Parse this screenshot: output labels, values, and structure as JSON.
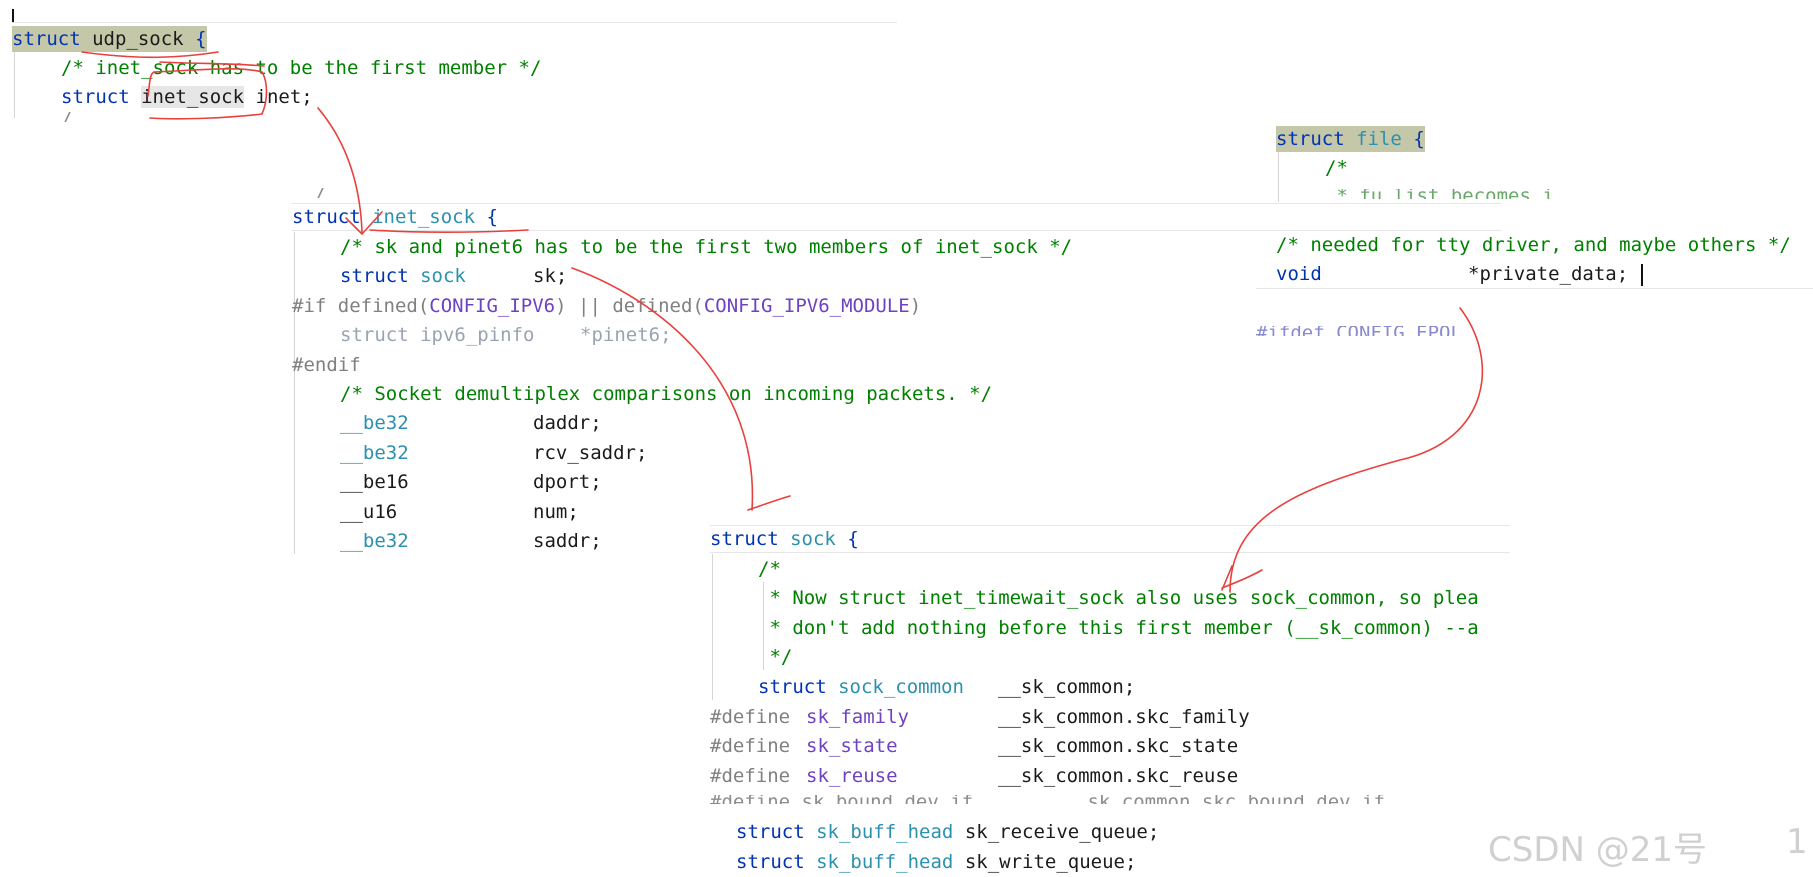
{
  "snippet_udp": {
    "header": [
      "struct",
      "udp_sock",
      "{"
    ],
    "line1": "/* inet_sock has to be the first member */",
    "line2_kw": "struct",
    "line2_type": "inet_sock",
    "line2_rest": "inet;",
    "line3_clipped": "/ ...   ...   ...   ...   ...   ..."
  },
  "snippet_inet": {
    "clipped_top": "/",
    "header": [
      "struct",
      "inet_sock",
      "{"
    ],
    "lines": [
      {
        "cm": "/* sk and pinet6 has to be the first two members of inet_sock */"
      },
      {
        "kw": "struct",
        "ty": "sock",
        "name": "sk;"
      },
      {
        "pp": "#if defined(",
        "mac1": "CONFIG_IPV6",
        "pp2": ") || defined(",
        "mac2": "CONFIG_IPV6_MODULE",
        "pp3": ")"
      },
      {
        "dimkw": "struct",
        "dimty": "ipv6_pinfo",
        "dimname": "*pinet6;"
      },
      {
        "pp": "#endif"
      },
      {
        "cm": "/* Socket demultiplex comparisons on incoming packets. */"
      },
      {
        "ty": "__be32",
        "name": "daddr;"
      },
      {
        "ty": "__be32",
        "name": "rcv_saddr;"
      },
      {
        "ty": "__be16",
        "name": "dport;"
      },
      {
        "ty": "__u16",
        "name": "num;"
      },
      {
        "ty": "__be32",
        "name": "saddr;"
      }
    ]
  },
  "snippet_file": {
    "header": [
      "struct",
      "file",
      "{"
    ],
    "c1": "/*",
    "c2_clipped": " * fu_list becomes i",
    "comment": "/* needed for tty driver, and maybe others */",
    "void": "void",
    "private": "*private_data;",
    "clipped_bottom": "#ifdef CONFIG_EPOLL"
  },
  "snippet_sock": {
    "header": [
      "struct",
      "sock",
      "{"
    ],
    "c_open": "/*",
    "c1": " * Now struct inet_timewait_sock also uses sock_common, so plea",
    "c2": " * don't add nothing before this first member (__sk_common) --a",
    "c_close": " */",
    "member_kw": "struct",
    "member_ty": "sock_common",
    "member_name": "__sk_common;",
    "defines": [
      {
        "pp": "#define",
        "mac": "sk_family",
        "val": "__sk_common.skc_family"
      },
      {
        "pp": "#define",
        "mac": "sk_state",
        "val": "__sk_common.skc_state"
      },
      {
        "pp": "#define",
        "mac": "sk_reuse",
        "val": "__sk_common.skc_reuse"
      }
    ],
    "clipped_define": "#define sk_bound_dev_if        __sk_common.skc_bound_dev_if",
    "queues": [
      {
        "kw": "struct",
        "ty": "sk_buff_head",
        "name": "sk_receive_queue;"
      },
      {
        "kw": "struct",
        "ty": "sk_buff_head",
        "name": "sk_write_queue;"
      }
    ]
  },
  "watermark": {
    "text": "CSDN @21号",
    "edge": "1"
  },
  "colors": {
    "keyword": "#0033b3",
    "type": "#2b91af",
    "comment": "#008000",
    "preprocessor": "#808080",
    "macro": "#6f42c1",
    "annotation": "#e8413d"
  }
}
